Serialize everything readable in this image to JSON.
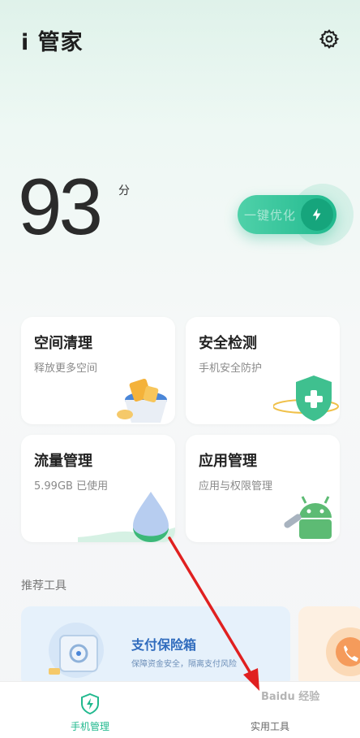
{
  "header": {
    "title": "i 管家",
    "settings_icon": "gear-icon"
  },
  "score": {
    "value": "93",
    "unit": "分"
  },
  "optimize": {
    "label": "一键优化",
    "icon": "lightning-icon"
  },
  "cards": [
    {
      "title": "空间清理",
      "subtitle": "释放更多空间",
      "icon": "cleaning-bucket-icon"
    },
    {
      "title": "安全检测",
      "subtitle": "手机安全防护",
      "icon": "shield-plus-icon"
    },
    {
      "title": "流量管理",
      "subtitle": "5.99GB 已使用",
      "icon": "water-drop-icon"
    },
    {
      "title": "应用管理",
      "subtitle": "应用与权限管理",
      "icon": "android-wrench-icon"
    }
  ],
  "recommended": {
    "section_title": "推荐工具",
    "tools": [
      {
        "title": "支付保险箱",
        "desc": "保障资金安全，隔离支付风险",
        "icon": "safe-box-icon"
      },
      {
        "title": "",
        "desc": "",
        "icon": "phone-icon"
      }
    ]
  },
  "nav": [
    {
      "label": "手机管理",
      "icon": "shield-bolt-icon",
      "active": true
    },
    {
      "label": "实用工具",
      "icon": "toolbox-icon",
      "active": false
    }
  ],
  "watermark": "Baidu 经验",
  "colors": {
    "accent": "#21b98e",
    "tool_blue": "#2f6bbd",
    "annotation": "#e02020"
  }
}
